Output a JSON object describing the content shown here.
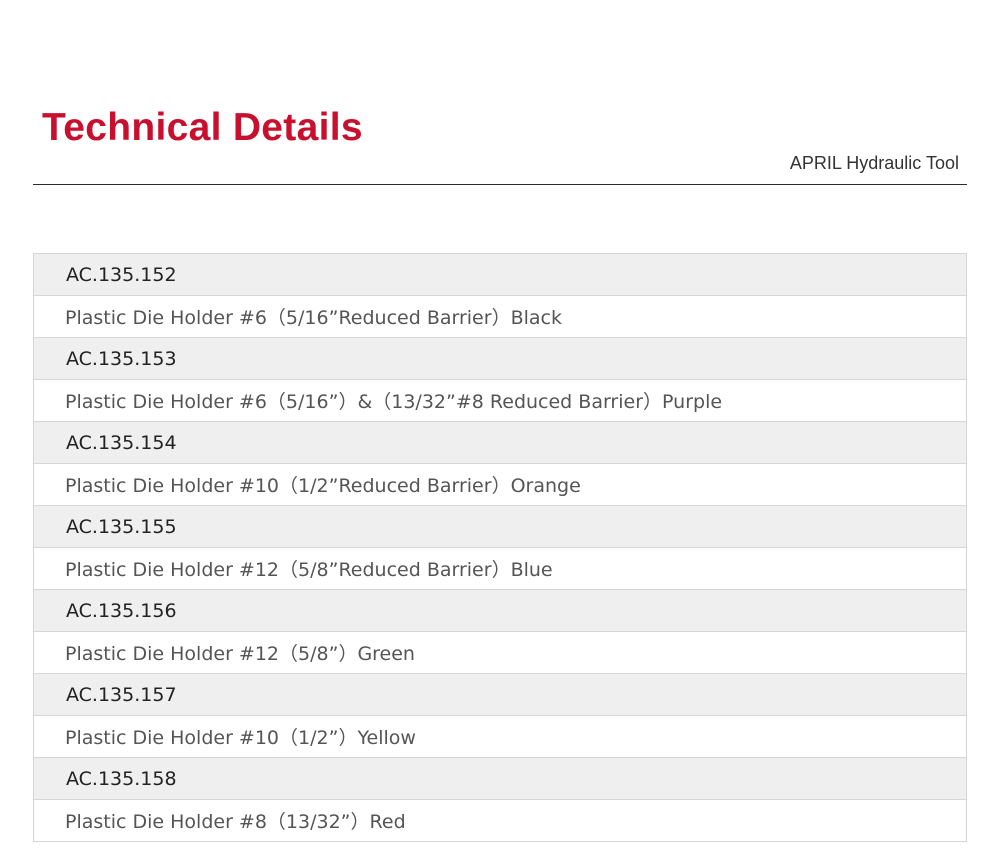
{
  "header": {
    "title": "Technical Details",
    "brand": "APRIL Hydraulic Tool"
  },
  "colors": {
    "title": "#c8102e",
    "code_row_bg": "#efefef",
    "border": "#d6d6d6"
  },
  "items": [
    {
      "code": "AC.135.152",
      "description": "Plastic Die Holder #6（5/16”Reduced Barrier）Black"
    },
    {
      "code": "AC.135.153",
      "description": "Plastic Die Holder #6（5/16”）&（13/32”#8 Reduced Barrier）Purple"
    },
    {
      "code": "AC.135.154",
      "description": "Plastic Die Holder #10（1/2”Reduced Barrier）Orange"
    },
    {
      "code": "AC.135.155",
      "description": "Plastic Die Holder #12（5/8”Reduced Barrier）Blue"
    },
    {
      "code": "AC.135.156",
      "description": "Plastic Die Holder #12（5/8”）Green"
    },
    {
      "code": "AC.135.157",
      "description": "Plastic Die Holder #10（1/2”）Yellow"
    },
    {
      "code": "AC.135.158",
      "description": "Plastic Die Holder #8（13/32”）Red"
    }
  ]
}
